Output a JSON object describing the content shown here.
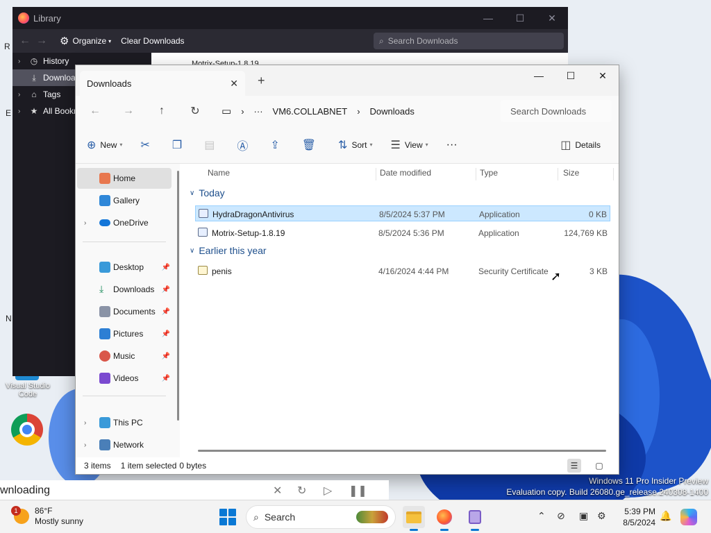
{
  "desktop": {
    "icons": [
      {
        "label": "Visual Studio Code"
      },
      {
        "label": "Chrome"
      }
    ],
    "watermark": {
      "line1": "Windows 11 Pro Insider Preview",
      "line2": "Evaluation copy. Build 26080.ge_release.240308-1400"
    }
  },
  "library": {
    "title": "Library",
    "toolbar": {
      "organize": "Organize",
      "clear": "Clear Downloads",
      "search_placeholder": "Search Downloads"
    },
    "sidebar": [
      {
        "label": "History",
        "icon": "clock-icon"
      },
      {
        "label": "Downloads",
        "icon": "download-icon"
      },
      {
        "label": "Tags",
        "icon": "tag-icon"
      },
      {
        "label": "All Bookmarks",
        "icon": "star-icon"
      }
    ],
    "peek_text": "Motrix-Setup-1.8.19"
  },
  "explorer": {
    "tab_title": "Downloads",
    "breadcrumb": {
      "more": "···",
      "pc": "VM6.COLLABNET",
      "folder": "Downloads"
    },
    "search_placeholder": "Search Downloads",
    "commands": {
      "new": "New",
      "sort": "Sort",
      "view": "View",
      "more": "···",
      "details": "Details"
    },
    "nav": {
      "home": "Home",
      "gallery": "Gallery",
      "onedrive": "OneDrive",
      "desktop": "Desktop",
      "downloads": "Downloads",
      "documents": "Documents",
      "pictures": "Pictures",
      "music": "Music",
      "videos": "Videos",
      "thispc": "This PC",
      "network": "Network"
    },
    "columns": {
      "name": "Name",
      "date": "Date modified",
      "type": "Type",
      "size": "Size"
    },
    "groups": {
      "today": "Today",
      "earlier": "Earlier this year"
    },
    "files": [
      {
        "name": "HydraDragonAntivirus",
        "date": "8/5/2024 5:37 PM",
        "type": "Application",
        "size": "0 KB"
      },
      {
        "name": "Motrix-Setup-1.8.19",
        "date": "8/5/2024 5:36 PM",
        "type": "Application",
        "size": "124,769 KB"
      },
      {
        "name": "penis",
        "date": "4/16/2024 4:44 PM",
        "type": "Security Certificate",
        "size": "3 KB"
      }
    ],
    "status": {
      "count": "3 items",
      "selected": "1 item selected",
      "bytes": "0 bytes"
    }
  },
  "download_strip": {
    "text": "wnloading"
  },
  "taskbar": {
    "weather": {
      "temp": "86°F",
      "condition": "Mostly sunny",
      "badge": "1"
    },
    "search_label": "Search",
    "clock": {
      "time": "5:39 PM",
      "date": "8/5/2024"
    }
  }
}
